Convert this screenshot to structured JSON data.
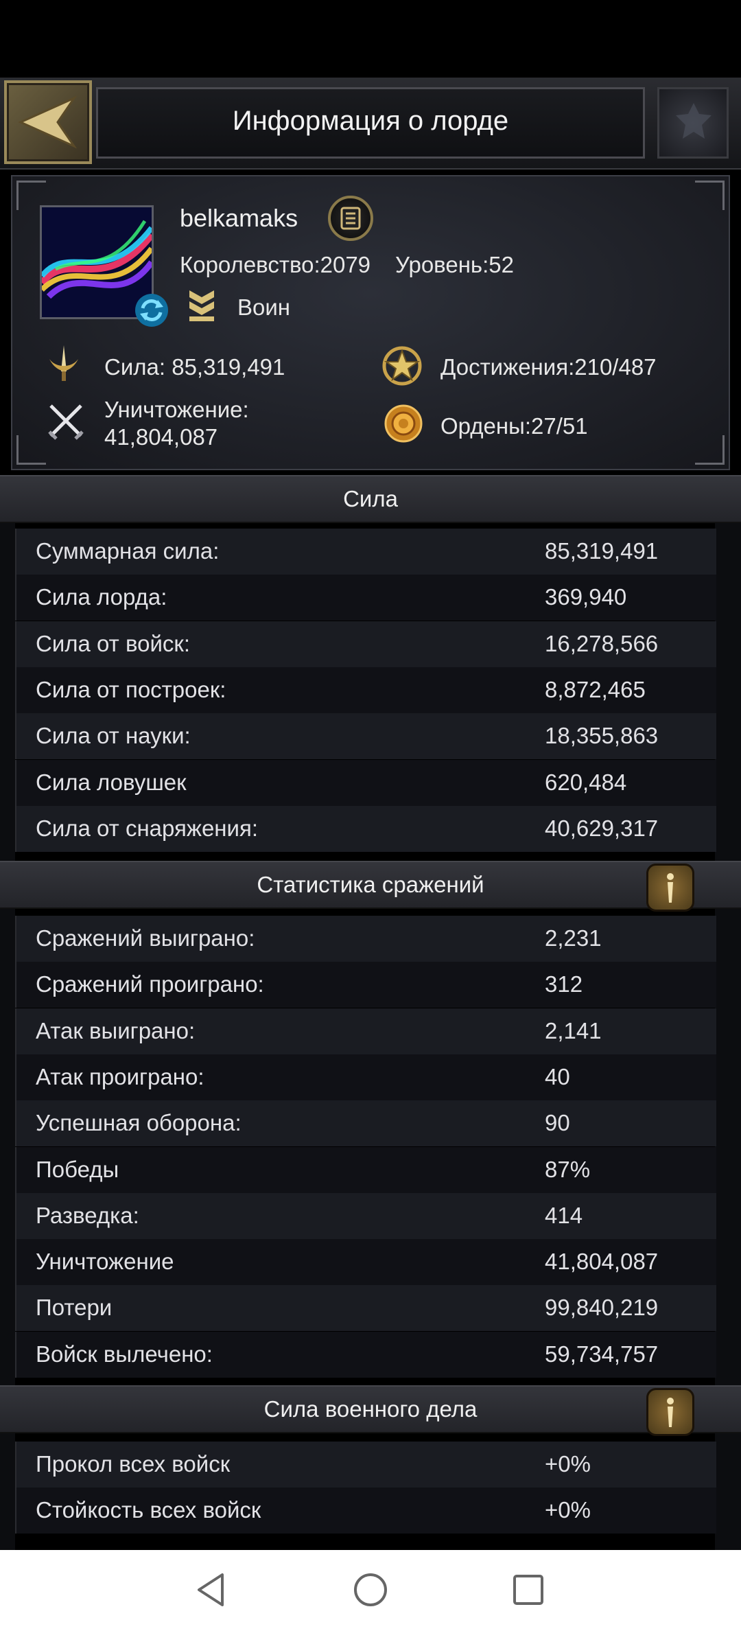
{
  "header": {
    "title": "Информация о лорде"
  },
  "profile": {
    "name": "belkamaks",
    "kingdom": "Королевство:2079",
    "level": "Уровень:52",
    "rank": "Воин",
    "power": "Сила: 85,319,491",
    "achievements": "Достижения:210/487",
    "kills_label": "Уничтожение:",
    "kills_value": "41,804,087",
    "medals": "Ордены:27/51"
  },
  "sections": {
    "power": {
      "title": "Сила",
      "rows": [
        {
          "label": "Суммарная сила:",
          "value": "85,319,491"
        },
        {
          "label": "Сила лорда:",
          "value": "369,940"
        },
        {
          "label": "Сила от войск:",
          "value": "16,278,566"
        },
        {
          "label": "Сила от построек:",
          "value": "8,872,465"
        },
        {
          "label": "Сила от науки:",
          "value": "18,355,863"
        },
        {
          "label": "Сила ловушек",
          "value": "620,484"
        },
        {
          "label": "Сила от снаряжения:",
          "value": "40,629,317"
        }
      ]
    },
    "battle": {
      "title": "Статистика сражений",
      "rows": [
        {
          "label": "Сражений выиграно:",
          "value": "2,231"
        },
        {
          "label": "Сражений проиграно:",
          "value": "312"
        },
        {
          "label": "Атак выиграно:",
          "value": "2,141"
        },
        {
          "label": "Атак проиграно:",
          "value": "40"
        },
        {
          "label": "Успешная оборона:",
          "value": "90"
        },
        {
          "label": "Победы",
          "value": "87%"
        },
        {
          "label": "Разведка:",
          "value": "414"
        },
        {
          "label": "Уничтожение",
          "value": "41,804,087"
        },
        {
          "label": "Потери",
          "value": "99,840,219"
        },
        {
          "label": "Войск вылечено:",
          "value": "59,734,757"
        }
      ]
    },
    "military": {
      "title": "Сила военного дела",
      "rows": [
        {
          "label": "Прокол всех войск",
          "value": "+0%"
        },
        {
          "label": "Стойкость всех войск",
          "value": "+0%"
        }
      ]
    }
  },
  "colors": {
    "gold": "#c9a24a",
    "accent_bronze": "#8a6a32",
    "row_odd": "#1a1c22",
    "row_even": "#101116"
  },
  "icons": [
    "back-arrow-icon",
    "emblem-icon",
    "notes-icon",
    "swap-icon",
    "rank-chevron-icon",
    "sword-power-icon",
    "achievement-star-icon",
    "crossed-swords-icon",
    "medal-icon",
    "info-icon",
    "nav-back-icon",
    "nav-home-icon",
    "nav-recents-icon"
  ]
}
